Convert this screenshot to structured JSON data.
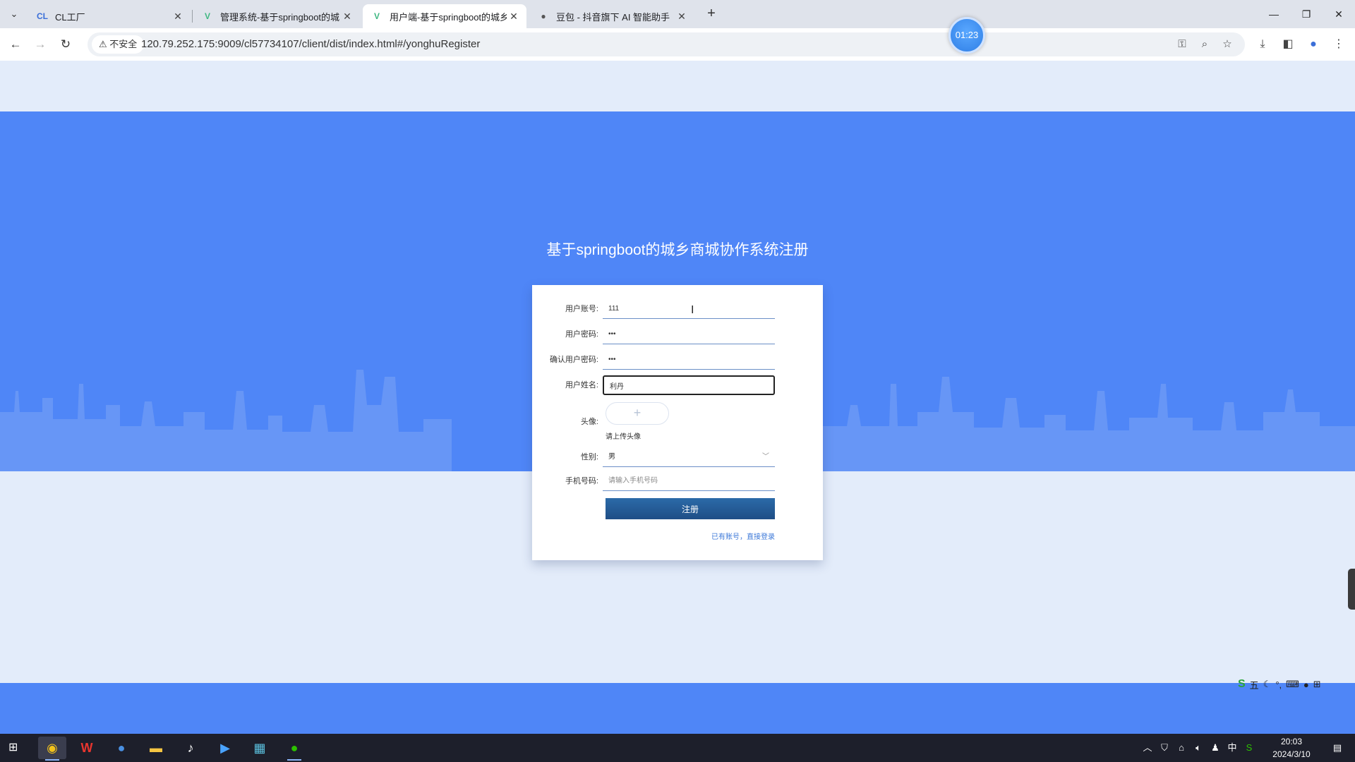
{
  "browser": {
    "tabs": [
      {
        "title": "CL工厂",
        "favicon": "cl-logo-icon",
        "active": false
      },
      {
        "title": "管理系统-基于springboot的城",
        "favicon": "vue-logo-icon",
        "active": false
      },
      {
        "title": "用户端-基于springboot的城乡",
        "favicon": "vue-logo-icon",
        "active": true
      },
      {
        "title": "豆包 - 抖音旗下 AI 智能助手",
        "favicon": "doubao-logo-icon",
        "active": false
      }
    ],
    "timer": "01:23",
    "security_label": "不安全",
    "url": "120.79.252.175:9009/cl57734107/client/dist/index.html#/yonghuRegister"
  },
  "page": {
    "title": "基于springboot的城乡商城协作系统注册",
    "form": {
      "account": {
        "label": "用户账号:",
        "value": "111",
        "placeholder": ""
      },
      "password": {
        "label": "用户密码:",
        "value": "111",
        "placeholder": ""
      },
      "confirm_password": {
        "label": "确认用户密码:",
        "value": "111",
        "placeholder": ""
      },
      "name": {
        "label": "用户姓名:",
        "value": "利丹",
        "placeholder": ""
      },
      "avatar": {
        "label": "头像:",
        "upload_symbol": "+",
        "tip": "请上传头像"
      },
      "gender": {
        "label": "性别:",
        "selected": "男"
      },
      "phone": {
        "label": "手机号码:",
        "value": "",
        "placeholder": "请输入手机号码"
      },
      "submit_label": "注册",
      "login_link": "已有账号，直接登录"
    }
  },
  "system": {
    "clock_time": "20:03",
    "clock_date": "2024/3/10",
    "ime_label": "五",
    "ime_lang": "中"
  },
  "colors": {
    "band": "#4f86f7",
    "page_bg": "#e3ecfa",
    "submit": "#1f4e86",
    "link": "#3c78d8"
  }
}
